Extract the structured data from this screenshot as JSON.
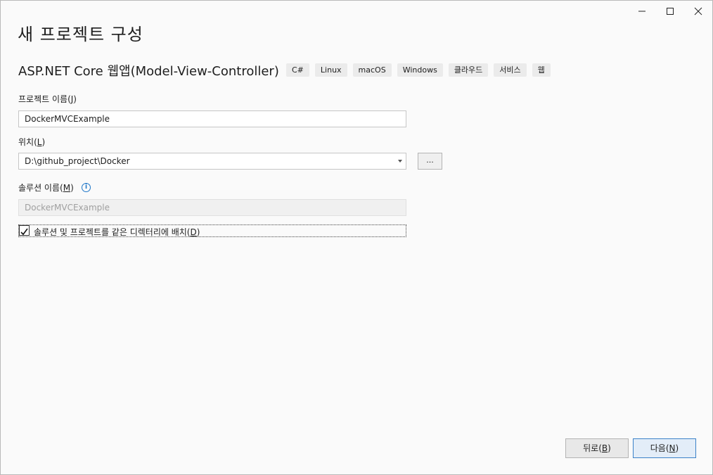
{
  "window": {
    "title": "새 프로젝트 구성"
  },
  "template": {
    "name": "ASP.NET Core 웹앱(Model-View-Controller)",
    "tags": [
      "C#",
      "Linux",
      "macOS",
      "Windows",
      "클라우드",
      "서비스",
      "웹"
    ]
  },
  "form": {
    "project_name_label": "프로젝트 이름",
    "project_name_key": "J",
    "project_name_value": "DockerMVCExample",
    "location_label": "위치",
    "location_key": "L",
    "location_value": "D:\\github_project\\Docker",
    "browse_label": "...",
    "solution_name_label": "솔루션 이름",
    "solution_name_key": "M",
    "solution_name_value": "DockerMVCExample",
    "same_dir_label": "솔루션 및 프로젝트를 같은 디렉터리에 배치",
    "same_dir_key": "D",
    "same_dir_checked": true
  },
  "footer": {
    "back_label": "뒤로",
    "back_key": "B",
    "next_label": "다음",
    "next_key": "N"
  }
}
